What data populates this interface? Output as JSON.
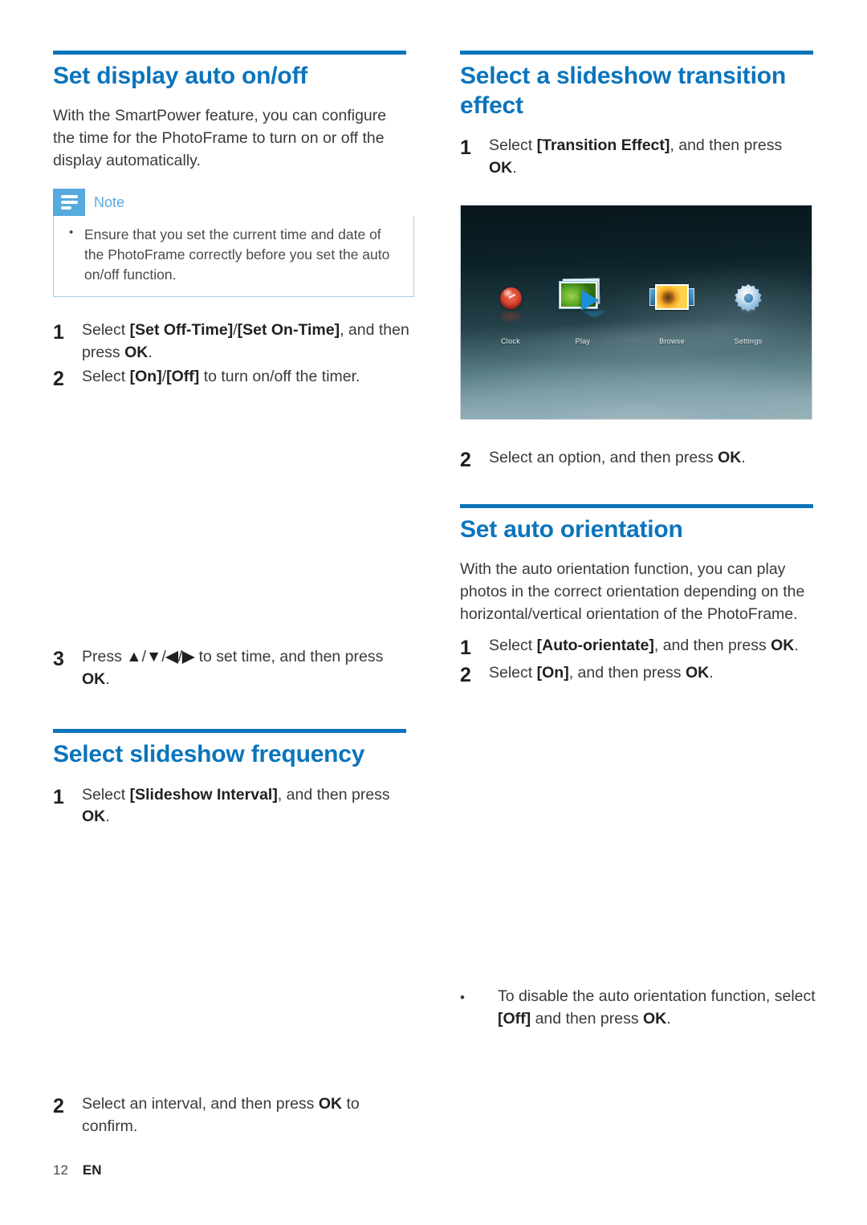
{
  "page": {
    "number": "12",
    "language": "EN",
    "accent_color": "#0b74bc",
    "note_accent_color": "#57aade"
  },
  "left_column": {
    "section_1": {
      "title": "Set display auto on/off",
      "intro": "With the SmartPower feature, you can configure the time for the PhotoFrame to turn on or off the display automatically.",
      "note": {
        "label": "Note",
        "items": [
          "Ensure that you set the current time and date of the PhotoFrame correctly before you set the auto on/off function."
        ]
      },
      "steps": [
        {
          "num": "1",
          "text_html": "Select <b>[Set Off-Time]</b>/<b>[Set On-Time]</b>, and then press <b>OK</b>."
        },
        {
          "num": "2",
          "text_html": "Select <b>[On]</b>/<b>[Off]</b> to turn on/off the timer."
        },
        {
          "num": "3",
          "text_html": "Press <b>▲</b>/<b>▼</b>/<b>◀</b>/<b>▶</b> to set time, and then press <b>OK</b>."
        }
      ]
    },
    "section_2": {
      "title": "Select slideshow frequency",
      "steps": [
        {
          "num": "1",
          "text_html": "Select <b>[Slideshow Interval]</b>, and then press <b>OK</b>."
        },
        {
          "num": "2",
          "text_html": "Select an interval, and then press <b>OK</b> to confirm."
        }
      ]
    }
  },
  "right_column": {
    "section_1": {
      "title": "Select a slideshow transition effect",
      "steps_before_image": [
        {
          "num": "1",
          "text_html": "Select <b>[Transition Effect]</b>, and then press <b>OK</b>."
        }
      ],
      "screenshot": {
        "caption_items": [
          {
            "label": "Clock",
            "icon": "clock-sphere-icon"
          },
          {
            "label": "Play",
            "icon": "play-photo-arrow-icon"
          },
          {
            "label": "Browse",
            "icon": "browse-photo-strip-icon"
          },
          {
            "label": "Settings",
            "icon": "gear-icon"
          }
        ]
      },
      "steps_after_image": [
        {
          "num": "2",
          "text_html": "Select an option, and then press <b>OK</b>."
        }
      ]
    },
    "section_2": {
      "title": "Set auto orientation",
      "intro": "With the auto orientation function, you can play photos in the correct orientation depending on the horizontal/vertical orientation of the PhotoFrame.",
      "steps": [
        {
          "num": "1",
          "text_html": "Select <b>[Auto-orientate]</b>, and then press <b>OK</b>."
        },
        {
          "num": "2",
          "text_html": "Select <b>[On]</b>, and then press <b>OK</b>."
        }
      ],
      "bullets": [
        {
          "text_html": "To disable the auto orientation function, select <b>[Off]</b> and then press <b>OK</b>."
        }
      ]
    }
  }
}
